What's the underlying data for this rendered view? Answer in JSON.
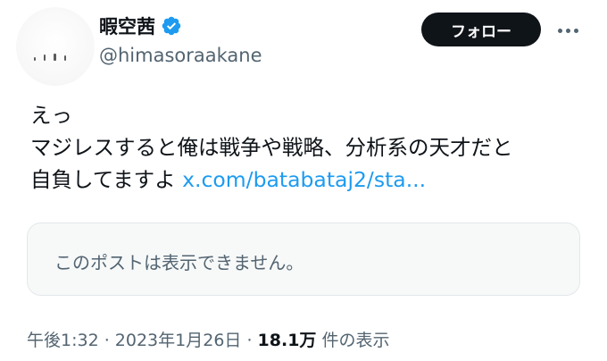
{
  "author": {
    "display_name": "暇空茜",
    "handle": "@himasoraakane",
    "verified_icon": "verified-badge-icon",
    "verified_color": "#1d9bf0"
  },
  "actions": {
    "follow_label": "フォロー",
    "more_icon": "more-horizontal-icon"
  },
  "tweet": {
    "line1": "えっ",
    "line2": "マジレスすると俺は戦争や戦略、分析系の天才だと",
    "line3_text": "自負してますよ ",
    "link_text": "x.com/batabataj2/sta..."
  },
  "quote": {
    "text": "このポストは表示できません。"
  },
  "meta": {
    "timestamp": "午後1:32 · 2023年1月26日 · ",
    "views_count": "18.1万",
    "views_label": " 件の表示"
  },
  "colors": {
    "text": "#0f1419",
    "secondary": "#536471",
    "link": "#1d9bf0",
    "button_bg": "#0f1419"
  }
}
